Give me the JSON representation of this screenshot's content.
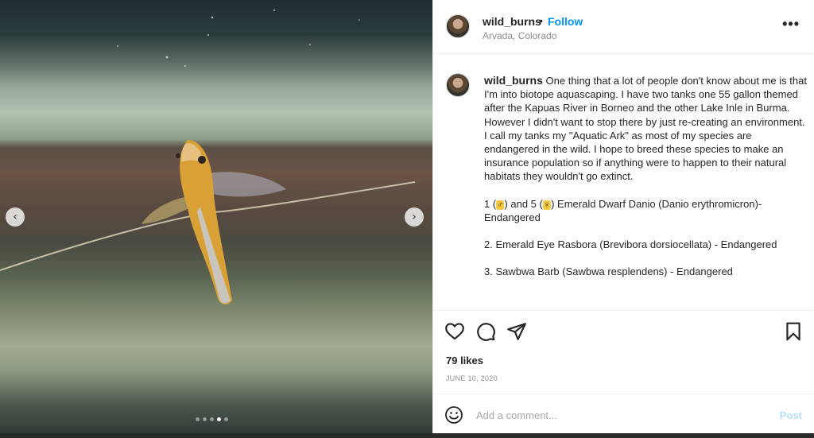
{
  "post": {
    "username": "wild_burns",
    "separator": "•",
    "follow_label": "Follow",
    "location": "Arvada, Colorado",
    "more_icon": "more-options-icon",
    "caption": {
      "username": "wild_burns",
      "line1": "One thing that a lot of people don't know about me is that I'm into biotope aquascaping. I have two tanks one 55 gallon themed after the Kapuas River in Borneo and the other Lake Inle in Burma.",
      "line2": "However I didn't want to stop there by just re-creating an environment. I call my tanks my \"Aquatic Ark\" as most of my species are endangered in the wild. I hope to breed these species to make an insurance population so if anything were to happen to their natural habitats they wouldn't go extinct.",
      "species1_a": "1 (",
      "species1_male": "♂",
      "species1_b": ") and 5 (",
      "species1_female": "♀",
      "species1_c": ") Emerald Dwarf Danio (Danio erythromicron)- Endangered",
      "species2": "2. Emerald Eye Rasbora (Brevibora dorsiocellata) - Endangered",
      "species3": "3. Sawbwa Barb (Sawbwa resplendens) - Endangered"
    },
    "likes": "79 likes",
    "date": "JUNE 10, 2020",
    "comment": {
      "placeholder": "Add a comment...",
      "value": "",
      "post_label": "Post"
    },
    "carousel": {
      "prev": "‹",
      "next": "›",
      "slide_count": 5,
      "active_slide": 4
    }
  },
  "colors": {
    "accent": "#0095f6",
    "post_disabled": "#b2dffc",
    "secondary_text": "#8e8e8e"
  }
}
